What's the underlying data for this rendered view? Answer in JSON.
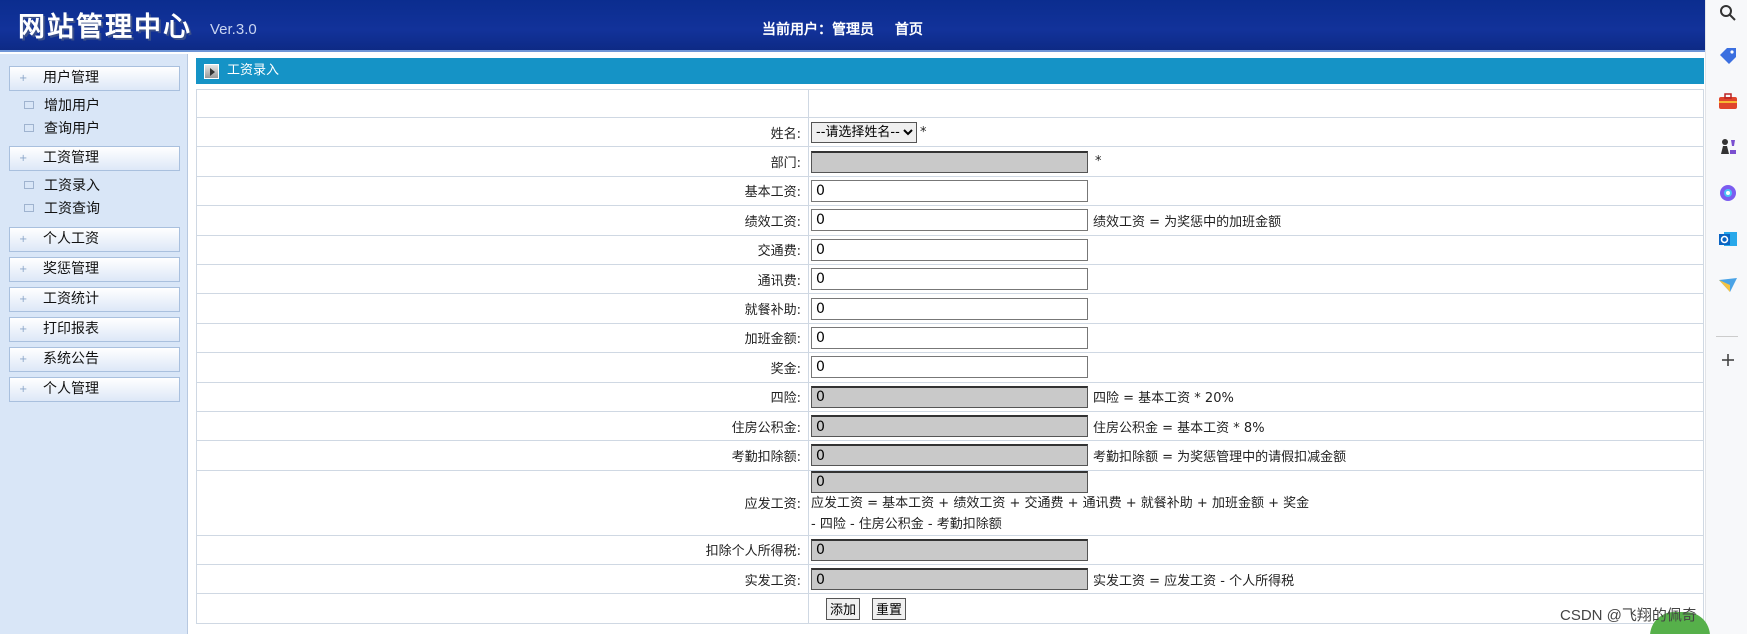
{
  "header": {
    "logo": "网站管理中心",
    "version": "Ver.3.0",
    "current_user_label": "当前用户：管理员",
    "home_link": "首页"
  },
  "sidebar": {
    "groups": [
      {
        "label": "用户管理",
        "items": [
          "增加用户",
          "查询用户"
        ]
      },
      {
        "label": "工资管理",
        "items": [
          "工资录入",
          "工资查询"
        ]
      },
      {
        "label": "个人工资",
        "items": []
      },
      {
        "label": "奖惩管理",
        "items": []
      },
      {
        "label": "工资统计",
        "items": []
      },
      {
        "label": "打印报表",
        "items": []
      },
      {
        "label": "系统公告",
        "items": []
      },
      {
        "label": "个人管理",
        "items": []
      }
    ]
  },
  "page": {
    "title": "工资录入"
  },
  "form": {
    "name_label": "姓名:",
    "name_select": "--请选择姓名--",
    "required_mark": "*",
    "dept_label": "部门:",
    "dept_value": "",
    "base_label": "基本工资:",
    "base_value": "0",
    "perf_label": "绩效工资:",
    "perf_value": "0",
    "perf_note": "绩效工资 = 为奖惩中的加班金额",
    "traffic_label": "交通费:",
    "traffic_value": "0",
    "comm_label": "通讯费:",
    "comm_value": "0",
    "meal_label": "就餐补助:",
    "meal_value": "0",
    "overtime_label": "加班金额:",
    "overtime_value": "0",
    "bonus_label": "奖金:",
    "bonus_value": "0",
    "insurance_label": "四险:",
    "insurance_value": "0",
    "insurance_note": "四险 = 基本工资 * 20%",
    "housing_label": "住房公积金:",
    "housing_value": "0",
    "housing_note": "住房公积金 = 基本工资 * 8%",
    "attendance_label": "考勤扣除额:",
    "attendance_value": "0",
    "attendance_note": "考勤扣除额 = 为奖惩管理中的请假扣减金额",
    "gross_label": "应发工资:",
    "gross_value": "0",
    "gross_note_line1": "应发工资 = 基本工资 + 绩效工资 + 交通费 + 通讯费 + 就餐补助 + 加班金额 + 奖金",
    "gross_note_line2": "- 四险 - 住房公积金 - 考勤扣除额",
    "tax_label": "扣除个人所得税:",
    "tax_value": "0",
    "net_label": "实发工资:",
    "net_value": "0",
    "net_note": "实发工资 = 应发工资 - 个人所得税",
    "add_button": "添加",
    "reset_button": "重置"
  },
  "watermark": "CSDN @飞翔的佩奇",
  "icons": {
    "browser_bar": [
      "search-icon",
      "tag-icon",
      "briefcase-icon",
      "chess-icon",
      "copilot-icon",
      "outlook-icon",
      "send-icon",
      "plus-icon"
    ]
  }
}
